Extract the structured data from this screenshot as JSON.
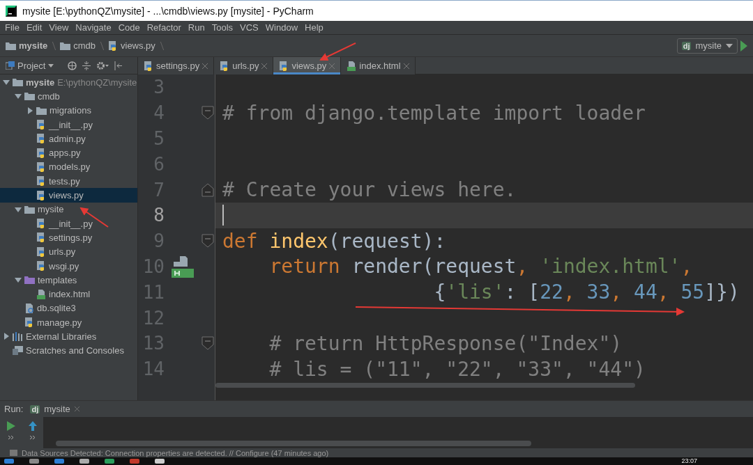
{
  "window": {
    "title": "mysite [E:\\pythonQZ\\mysite] - ...\\cmdb\\views.py [mysite] - PyCharm"
  },
  "menu": [
    "File",
    "Edit",
    "View",
    "Navigate",
    "Code",
    "Refactor",
    "Run",
    "Tools",
    "VCS",
    "Window",
    "Help"
  ],
  "breadcrumbs": [
    {
      "label": "mysite",
      "kind": "folder",
      "bold": true
    },
    {
      "label": "cmdb",
      "kind": "folder",
      "bold": false
    },
    {
      "label": "views.py",
      "kind": "python",
      "bold": false
    }
  ],
  "run_config": {
    "badge": "dj",
    "label": "mysite"
  },
  "project_panel": {
    "title": "Project"
  },
  "tabs": [
    {
      "label": "settings.py",
      "kind": "python",
      "selected": false
    },
    {
      "label": "urls.py",
      "kind": "python",
      "selected": false
    },
    {
      "label": "views.py",
      "kind": "python",
      "selected": true
    },
    {
      "label": "index.html",
      "kind": "html",
      "selected": false
    }
  ],
  "tree": [
    {
      "label": "mysite",
      "hint": "E:\\pythonQZ\\mysite",
      "kind": "folder",
      "expanded": true,
      "selected": false,
      "children": [
        {
          "label": "cmdb",
          "kind": "folder",
          "expanded": true,
          "selected": false,
          "children": [
            {
              "label": "migrations",
              "kind": "folder",
              "expanded": false,
              "selected": false
            },
            {
              "label": "__init__.py",
              "kind": "python",
              "selected": false
            },
            {
              "label": "admin.py",
              "kind": "python",
              "selected": false
            },
            {
              "label": "apps.py",
              "kind": "python",
              "selected": false
            },
            {
              "label": "models.py",
              "kind": "python",
              "selected": false
            },
            {
              "label": "tests.py",
              "kind": "python",
              "selected": false
            },
            {
              "label": "views.py",
              "kind": "python",
              "selected": true
            }
          ]
        },
        {
          "label": "mysite",
          "kind": "folder",
          "expanded": true,
          "selected": false,
          "children": [
            {
              "label": "__init__.py",
              "kind": "python",
              "selected": false
            },
            {
              "label": "settings.py",
              "kind": "python",
              "selected": false
            },
            {
              "label": "urls.py",
              "kind": "python",
              "selected": false
            },
            {
              "label": "wsgi.py",
              "kind": "python",
              "selected": false
            }
          ]
        },
        {
          "label": "templates",
          "kind": "templates",
          "expanded": true,
          "selected": false,
          "children": [
            {
              "label": "index.html",
              "kind": "html",
              "selected": false
            }
          ]
        },
        {
          "label": "db.sqlite3",
          "kind": "unknown",
          "selected": false
        },
        {
          "label": "manage.py",
          "kind": "python",
          "selected": false
        }
      ]
    },
    {
      "label": "External Libraries",
      "kind": "libraries",
      "expanded": false,
      "selected": false
    },
    {
      "label": "Scratches and Consoles",
      "kind": "scratches",
      "selected": false
    }
  ],
  "editor": {
    "lines": [
      {
        "number": "3",
        "current": false
      },
      {
        "number": "4",
        "current": false,
        "fold": {
          "kind": "start"
        },
        "tokens": [
          {
            "kind": "comment",
            "text": "# from django.template import loader"
          }
        ]
      },
      {
        "number": "5",
        "current": false
      },
      {
        "number": "6",
        "current": false
      },
      {
        "number": "7",
        "current": false,
        "fold": {
          "kind": "end"
        },
        "tokens": [
          {
            "kind": "comment",
            "text": "# Create your views here."
          }
        ]
      },
      {
        "number": "8",
        "current": true
      },
      {
        "number": "9",
        "current": false,
        "fold": {
          "kind": "start"
        },
        "tokens": [
          {
            "kind": "keyword",
            "text": "def "
          },
          {
            "kind": "function",
            "text": "index"
          },
          {
            "kind": "plain",
            "text": "(request):"
          }
        ]
      },
      {
        "number": "10",
        "current": false,
        "marker": {
          "kind": "html"
        },
        "tokens": [
          {
            "kind": "keyword",
            "text": "    return "
          },
          {
            "kind": "plain",
            "text": "render(request"
          },
          {
            "kind": "keyword",
            "text": ", "
          },
          {
            "kind": "string",
            "text": "'index.html'"
          },
          {
            "kind": "keyword",
            "text": ","
          }
        ]
      },
      {
        "number": "11",
        "current": false,
        "tokens": [
          {
            "kind": "plain",
            "text": "                  {"
          },
          {
            "kind": "string",
            "text": "'lis'"
          },
          {
            "kind": "plain",
            "text": ": ["
          },
          {
            "kind": "number",
            "text": "22"
          },
          {
            "kind": "keyword",
            "text": ", "
          },
          {
            "kind": "number",
            "text": "33"
          },
          {
            "kind": "keyword",
            "text": ", "
          },
          {
            "kind": "number",
            "text": "44"
          },
          {
            "kind": "keyword",
            "text": ", "
          },
          {
            "kind": "number",
            "text": "55"
          },
          {
            "kind": "plain",
            "text": "]})"
          }
        ]
      },
      {
        "number": "12",
        "current": false
      },
      {
        "number": "13",
        "current": false,
        "fold": {
          "kind": "start"
        },
        "tokens": [
          {
            "kind": "comment",
            "text": "    # return HttpResponse(\"Index\")"
          }
        ]
      },
      {
        "number": "14",
        "current": false,
        "tokens": [
          {
            "kind": "comment",
            "text": "    # lis = (\"11\", \"22\", \"33\", \"44\")"
          }
        ]
      }
    ]
  },
  "run": {
    "label": "Run:",
    "badge": "dj",
    "tab": "mysite"
  },
  "status_bar": {
    "text": "Data Sources Detected: Connection properties are detected. // Configure (47 minutes ago)"
  },
  "taskbar": {
    "clock": "23:07"
  }
}
